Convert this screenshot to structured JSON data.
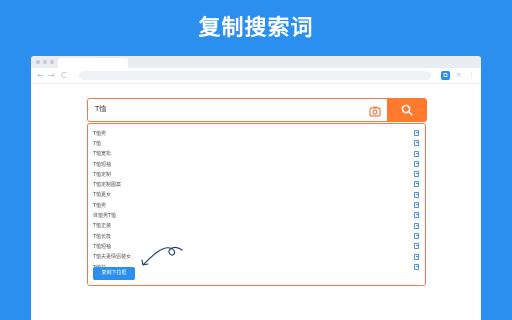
{
  "headline": "复制搜索词",
  "browser": {
    "nav_back": "←",
    "nav_forward": "→",
    "nav_reload": "C",
    "ext_icon": "search-copy-extension-icon",
    "toolbar_icon_1": "≋",
    "toolbar_icon_2": "⋮"
  },
  "search": {
    "query": "T恤"
  },
  "suggestions": [
    "T恤男",
    "T恤",
    "T恤宽松",
    "T恤短袖",
    "T恤定制",
    "T恤定制图案",
    "T恤夏女",
    "T恤男",
    "体恤男T恤",
    "T恤正装",
    "T恤长款",
    "T恤短袖",
    "T恤夫妻情侣装女",
    "T恤衫"
  ],
  "copy_button_label": "复制下拉框",
  "colors": {
    "background": "#2b8ff0",
    "accent_orange": "#ff7a2f",
    "border_orange": "#f07a4a",
    "button_blue": "#2b8ff0"
  }
}
